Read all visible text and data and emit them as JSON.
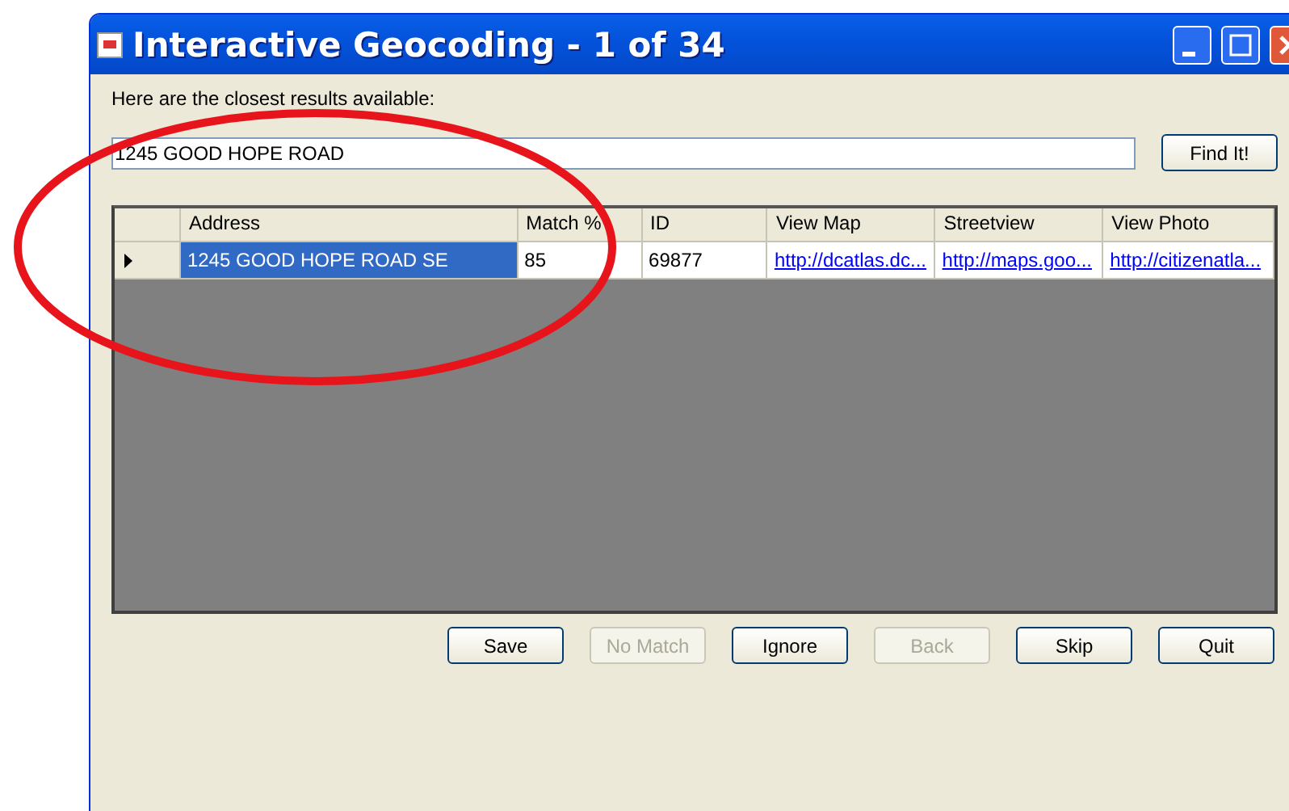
{
  "window": {
    "title": "Interactive Geocoding - 1 of 34"
  },
  "prompt": "Here are the closest results available:",
  "search": {
    "value": "1245 GOOD HOPE ROAD",
    "button": "Find It!"
  },
  "table": {
    "columns": [
      "Address",
      "Match %",
      "ID",
      "View Map",
      "Streetview",
      "View Photo"
    ],
    "rows": [
      {
        "selected": true,
        "cells": [
          {
            "kind": "text",
            "text": "1245 GOOD HOPE ROAD SE"
          },
          {
            "kind": "text",
            "text": "85"
          },
          {
            "kind": "text",
            "text": "69877"
          },
          {
            "kind": "link",
            "text": "http://dcatlas.dc..."
          },
          {
            "kind": "link",
            "text": "http://maps.goo..."
          },
          {
            "kind": "link",
            "text": "http://citizenatla..."
          }
        ]
      }
    ]
  },
  "buttons": [
    {
      "label": "Save",
      "disabled": false
    },
    {
      "label": "No Match",
      "disabled": true
    },
    {
      "label": "Ignore",
      "disabled": false
    },
    {
      "label": "Back",
      "disabled": true
    },
    {
      "label": "Skip",
      "disabled": false
    },
    {
      "label": "Quit",
      "disabled": false
    }
  ]
}
